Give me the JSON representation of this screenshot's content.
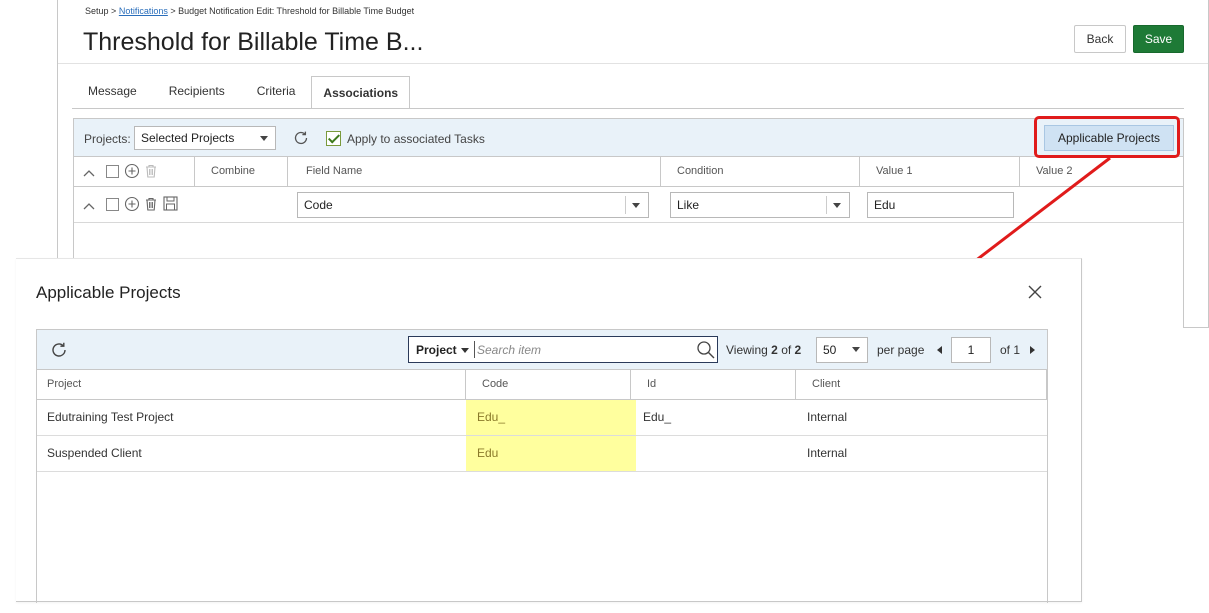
{
  "breadcrumb": {
    "setup": "Setup",
    "sep1": ">",
    "notifications": "Notifications",
    "sep2": ">",
    "current": "Budget Notification Edit: Threshold for Billable Time Budget"
  },
  "page": {
    "title": "Threshold for Billable Time B...",
    "back_label": "Back",
    "save_label": "Save"
  },
  "tabs": [
    {
      "label": "Message",
      "active": false
    },
    {
      "label": "Recipients",
      "active": false
    },
    {
      "label": "Criteria",
      "active": false
    },
    {
      "label": "Associations",
      "active": true
    }
  ],
  "toolbar": {
    "projects_label": "Projects:",
    "projects_value": "Selected Projects",
    "apply_tasks_label": "Apply to associated Tasks",
    "apply_tasks_checked": true,
    "applicable_projects_label": "Applicable Projects"
  },
  "criteria_grid": {
    "headers": [
      "Combine",
      "Field Name",
      "Condition",
      "Value 1",
      "Value 2"
    ],
    "rows": [
      {
        "field_name": "Code",
        "condition": "Like",
        "value1": "Edu",
        "value2": ""
      }
    ]
  },
  "modal": {
    "title": "Applicable Projects",
    "search": {
      "field": "Project",
      "placeholder": "Search item"
    },
    "pagination": {
      "viewing_prefix": "Viewing",
      "viewing_count": "2",
      "of_word": "of",
      "total": "2",
      "page_size": "50",
      "per_page_label": "per page",
      "page": "1",
      "of_pages": "of 1"
    },
    "columns": [
      "Project",
      "Code",
      "Id",
      "Client"
    ],
    "rows": [
      {
        "project": "Edutraining Test Project",
        "code": "Edu_",
        "id": "Edu_",
        "client": "Internal"
      },
      {
        "project": "Suspended Client",
        "code": "Edu",
        "id": "",
        "client": "Internal"
      }
    ]
  },
  "colors": {
    "save": "#1e7a36",
    "highlight_box": "#e01b1b",
    "arrow": "#e01b1b",
    "code_highlight": "#ffff9e",
    "toolbar_bg": "#e9f2f9"
  }
}
